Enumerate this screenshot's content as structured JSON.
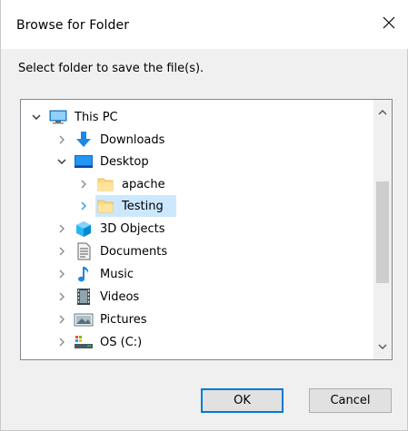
{
  "window": {
    "title": "Browse for Folder",
    "close_icon": "close-icon"
  },
  "instruction": "Select folder to save the file(s).",
  "tree": {
    "items": [
      {
        "label": "This PC",
        "icon": "pc-icon",
        "expanded": true,
        "level": 0
      },
      {
        "label": "Downloads",
        "icon": "downloads-icon",
        "expanded": false,
        "level": 1
      },
      {
        "label": "Desktop",
        "icon": "desktop-icon",
        "expanded": true,
        "level": 1
      },
      {
        "label": "apache",
        "icon": "folder-icon",
        "expanded": false,
        "level": 2
      },
      {
        "label": "Testing",
        "icon": "folder-icon",
        "expanded": false,
        "level": 2,
        "selected": true
      },
      {
        "label": "3D Objects",
        "icon": "3d-objects-icon",
        "expanded": false,
        "level": 1
      },
      {
        "label": "Documents",
        "icon": "documents-icon",
        "expanded": false,
        "level": 1
      },
      {
        "label": "Music",
        "icon": "music-icon",
        "expanded": false,
        "level": 1
      },
      {
        "label": "Videos",
        "icon": "videos-icon",
        "expanded": false,
        "level": 1
      },
      {
        "label": "Pictures",
        "icon": "pictures-icon",
        "expanded": false,
        "level": 1
      },
      {
        "label": "OS (C:)",
        "icon": "drive-icon",
        "expanded": false,
        "level": 1
      }
    ]
  },
  "buttons": {
    "ok": "OK",
    "cancel": "Cancel"
  },
  "colors": {
    "selection": "#cce8ff",
    "accent": "#0078d7",
    "folder": "#ffd97a"
  }
}
